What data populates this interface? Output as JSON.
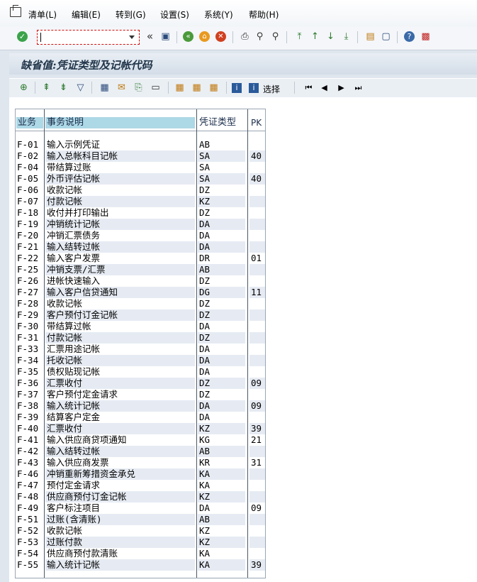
{
  "menu": [
    "清单(L)",
    "编辑(E)",
    "转到(G)",
    "设置(S)",
    "系统(Y)",
    "帮助(H)"
  ],
  "command_field": {
    "value": ""
  },
  "title": "缺省值:凭证类型及记帐代码",
  "toolbar2_select_label": "选择",
  "table": {
    "headers": [
      "业务",
      "事务说明",
      "凭证类型",
      "PK"
    ],
    "rows": [
      [
        "F-01",
        "输入示例凭证",
        "AB",
        ""
      ],
      [
        "F-02",
        "输入总帐科目记帐",
        "SA",
        "40"
      ],
      [
        "F-04",
        "带结算过账",
        "SA",
        ""
      ],
      [
        "F-05",
        "外币评估记帐",
        "SA",
        "40"
      ],
      [
        "F-06",
        "收款记帐",
        "DZ",
        ""
      ],
      [
        "F-07",
        "付款记帐",
        "KZ",
        ""
      ],
      [
        "F-18",
        "收付并打印输出",
        "DZ",
        ""
      ],
      [
        "F-19",
        "冲销统计记帐",
        "DA",
        ""
      ],
      [
        "F-20",
        "冲销汇票债务",
        "DA",
        ""
      ],
      [
        "F-21",
        "输入结转过帐",
        "DA",
        ""
      ],
      [
        "F-22",
        "输入客户发票",
        "DR",
        "01"
      ],
      [
        "F-25",
        "冲销支票/汇票",
        "AB",
        ""
      ],
      [
        "F-26",
        "进帐快速输入",
        "DZ",
        ""
      ],
      [
        "F-27",
        "输入客户信贷通知",
        "DG",
        "11"
      ],
      [
        "F-28",
        "收款记帐",
        "DZ",
        ""
      ],
      [
        "F-29",
        "客户预付订金记帐",
        "DZ",
        ""
      ],
      [
        "F-30",
        "带结算过帐",
        "DA",
        ""
      ],
      [
        "F-31",
        "付款记帐",
        "DZ",
        ""
      ],
      [
        "F-33",
        "汇票用途记帐",
        "DA",
        ""
      ],
      [
        "F-34",
        "托收记帐",
        "DA",
        ""
      ],
      [
        "F-35",
        "债权贴现记帐",
        "DA",
        ""
      ],
      [
        "F-36",
        "汇票收付",
        "DZ",
        "09"
      ],
      [
        "F-37",
        "客户预付定金请求",
        "DZ",
        ""
      ],
      [
        "F-38",
        "输入统计记帐",
        "DA",
        "09"
      ],
      [
        "F-39",
        "结算客户定金",
        "DA",
        ""
      ],
      [
        "F-40",
        "汇票收付",
        "KZ",
        "39"
      ],
      [
        "F-41",
        "输入供应商贷项通知",
        "KG",
        "21"
      ],
      [
        "F-42",
        "输入结转过帐",
        "AB",
        ""
      ],
      [
        "F-43",
        "输入供应商发票",
        "KR",
        "31"
      ],
      [
        "F-46",
        "冲销重新筹措资金承兑",
        "KA",
        ""
      ],
      [
        "F-47",
        "预付定金请求",
        "KA",
        ""
      ],
      [
        "F-48",
        "供应商预付订金记帐",
        "KZ",
        ""
      ],
      [
        "F-49",
        "客户标注项目",
        "DA",
        "09"
      ],
      [
        "F-51",
        "过账(含清账)",
        "AB",
        ""
      ],
      [
        "F-52",
        "收款记帐",
        "KZ",
        ""
      ],
      [
        "F-53",
        "过账付款",
        "KZ",
        ""
      ],
      [
        "F-54",
        "供应商预付款清账",
        "KA",
        ""
      ],
      [
        "F-55",
        "输入统计记帐",
        "KA",
        "39"
      ]
    ]
  }
}
